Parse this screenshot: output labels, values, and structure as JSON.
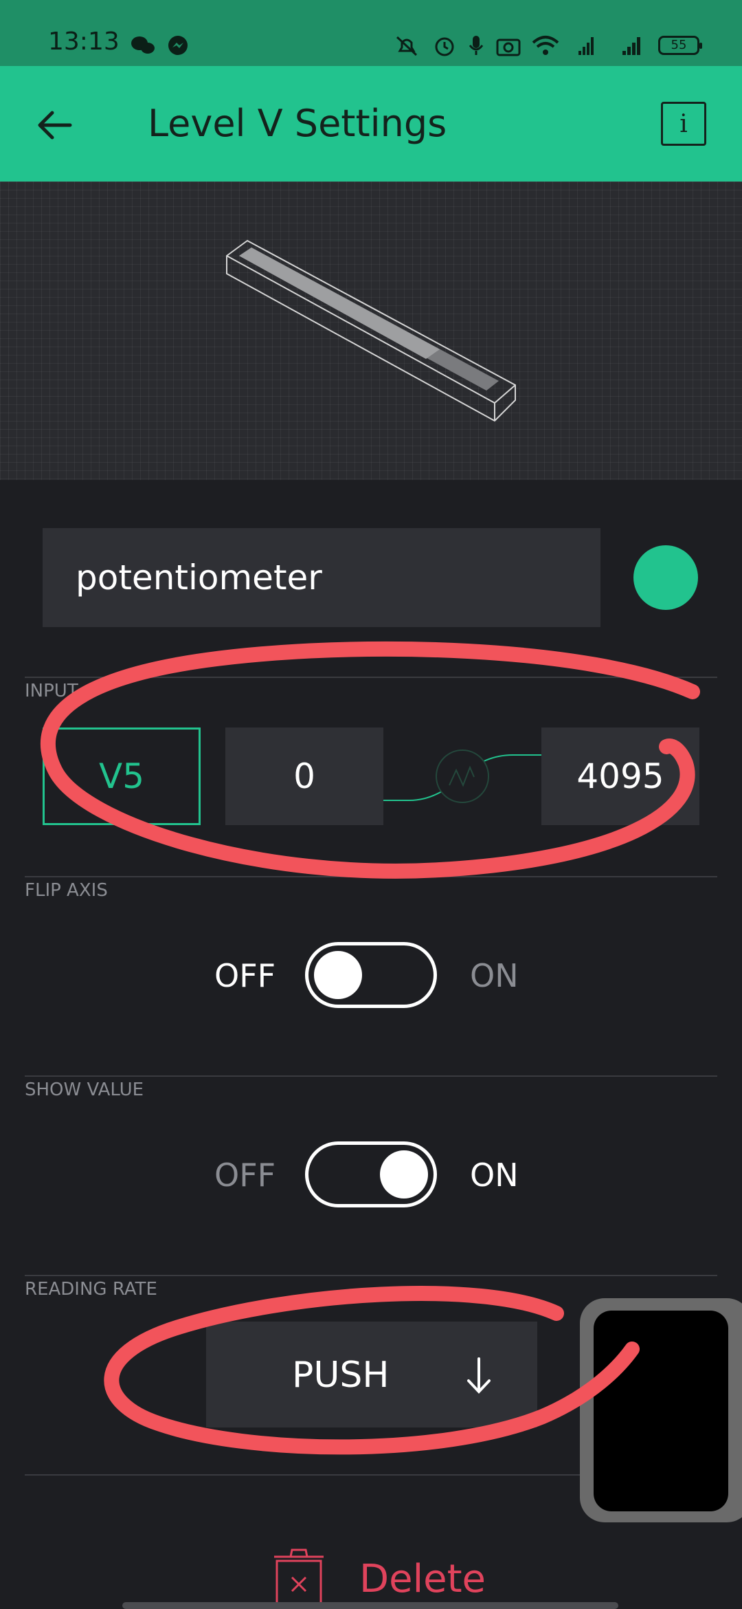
{
  "status_bar": {
    "time": "13:13",
    "battery": "55",
    "icons": [
      "wechat-icon",
      "messenger-icon",
      "mute-icon",
      "alarm-icon",
      "mic-icon",
      "camera-icon",
      "wifi-icon",
      "signal-4g-icon",
      "signal-3g-icon",
      "battery-icon"
    ]
  },
  "app_bar": {
    "title": "Level V Settings",
    "back_icon": "back-arrow-icon",
    "info_label": "i"
  },
  "colors": {
    "accent": "#22c38e",
    "background": "#1d1e22",
    "field": "#2f3035",
    "danger": "#e0435c",
    "annotation": "#f2545b"
  },
  "widget": {
    "name": "potentiometer",
    "color": "#22c38e"
  },
  "input": {
    "label": "INPUT",
    "pin": "V5",
    "min": "0",
    "max": "4095"
  },
  "flip_axis": {
    "label": "FLIP AXIS",
    "off": "OFF",
    "on": "ON",
    "enabled": false
  },
  "show_value": {
    "label": "SHOW VALUE",
    "off": "OFF",
    "on": "ON",
    "enabled": true
  },
  "reading_rate": {
    "label": "READING RATE",
    "value": "PUSH"
  },
  "delete": {
    "label": "Delete"
  }
}
